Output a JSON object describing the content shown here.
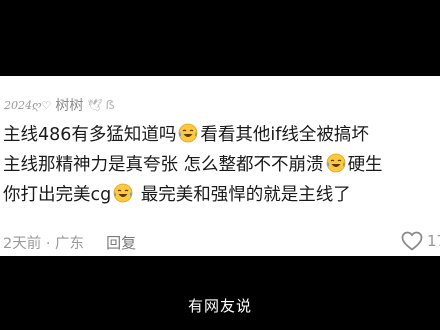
{
  "comment": {
    "author_tag": "2024ღ♡",
    "author_name": "树树",
    "author_badge_icon": "dove-icon",
    "author_badge_text": "ẞ",
    "lines": [
      {
        "segments": [
          "主线486有多猛知道吗",
          "看看其他if线全被搞坏"
        ]
      },
      {
        "segments": [
          "主线那精神力是真夸张 怎么整都不不崩溃",
          "硬生"
        ]
      },
      {
        "segments": [
          "你打出完美cg",
          " 最完美和强悍的就是主线了"
        ]
      }
    ],
    "emoji": "laughing-crying-emoji",
    "time_location": "2天前 · 广东",
    "reply_label": "回复",
    "like_count": "17"
  },
  "video_caption": "有网友说",
  "colors": {
    "background": "#000000",
    "card": "#ffffff",
    "text": "#1a1a1a",
    "meta": "#9a9a9a",
    "emoji_face": "#ffc83d",
    "emoji_tear": "#4ea8ff"
  }
}
